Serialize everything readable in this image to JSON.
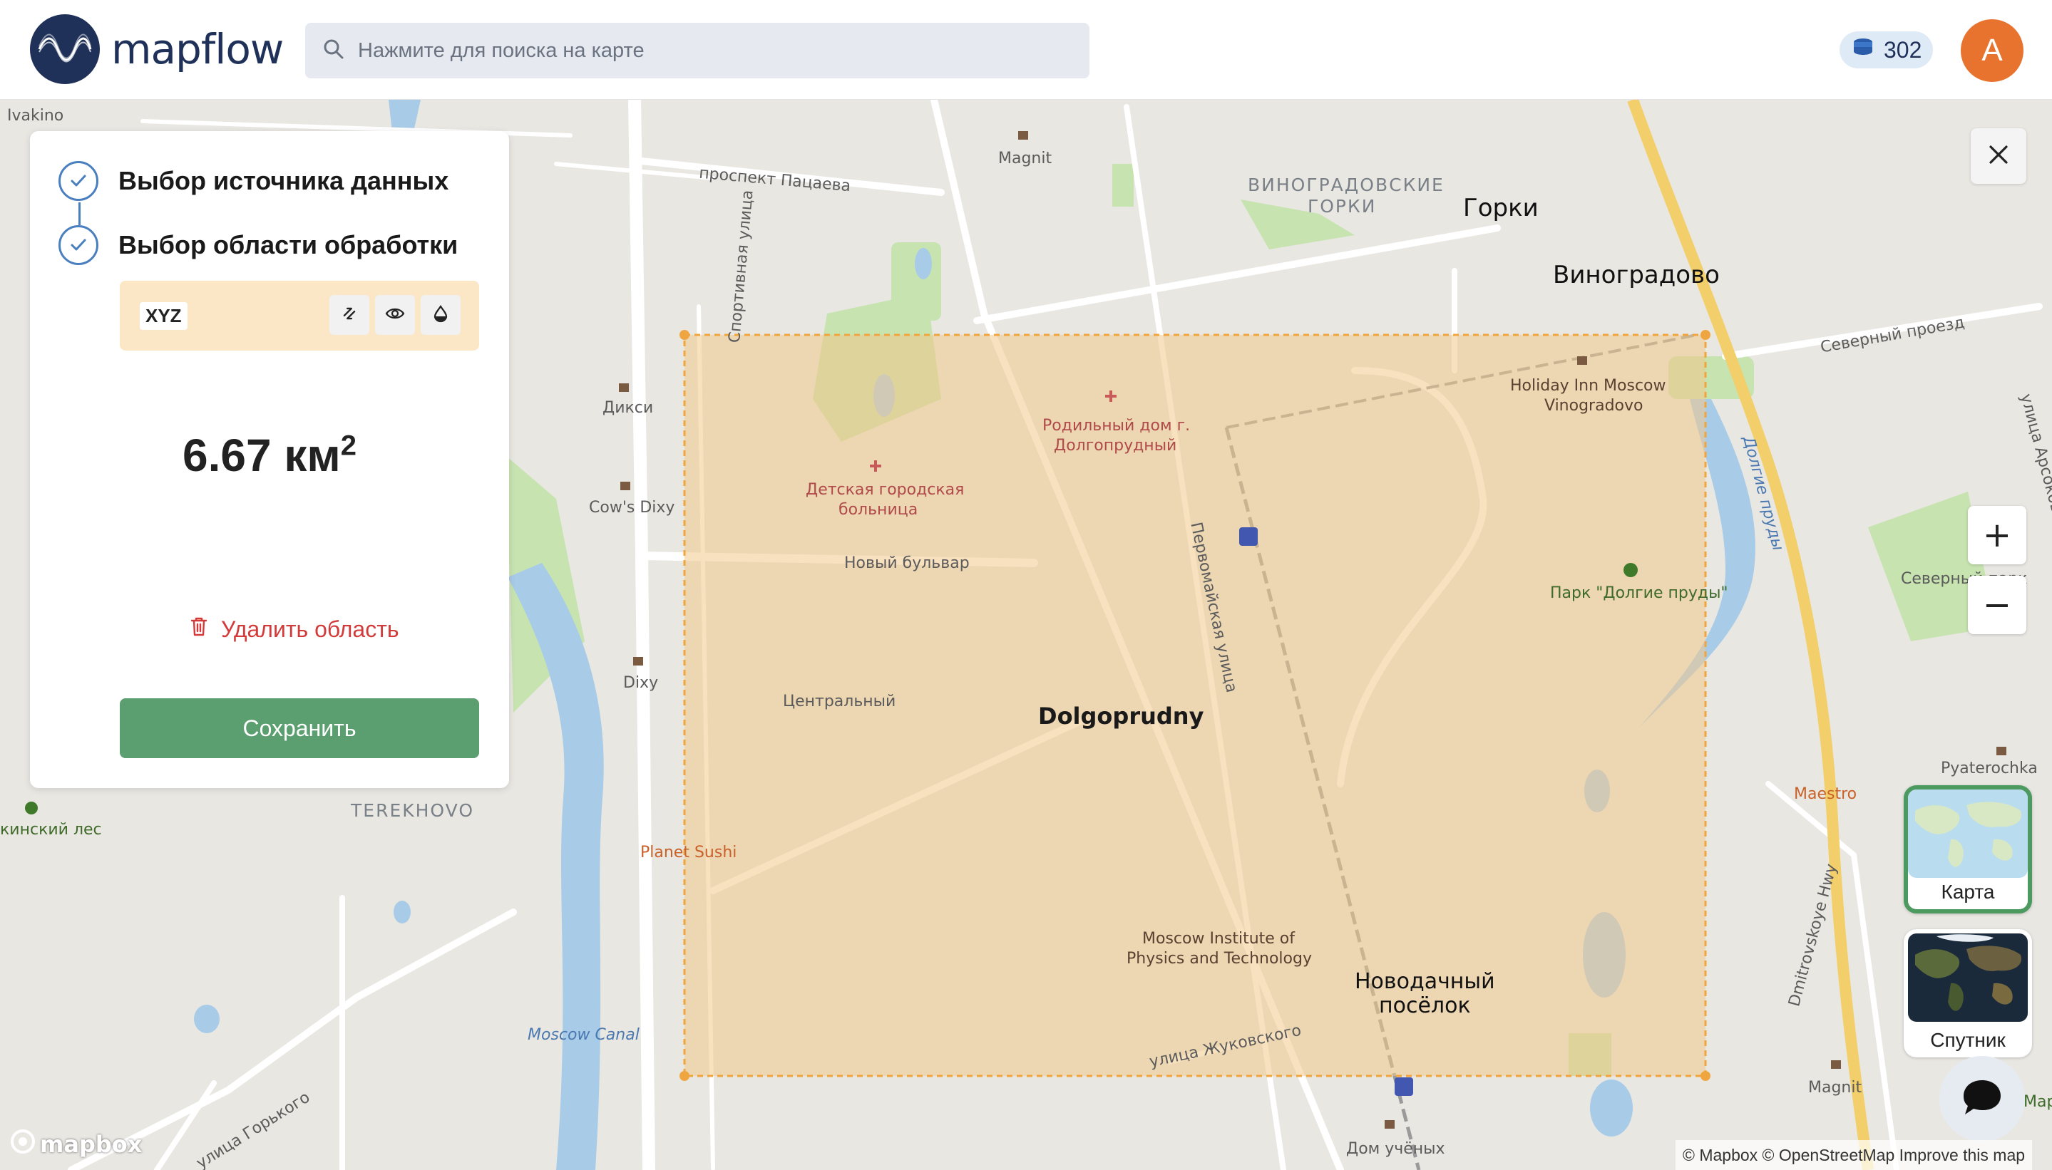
{
  "header": {
    "logo_text": "mapflow",
    "search_placeholder": "Нажмите для поиска на карте",
    "balance": "302",
    "avatar_initial": "A"
  },
  "panel": {
    "steps": [
      {
        "label": "Выбор источника данных",
        "done": true
      },
      {
        "label": "Выбор области обработки",
        "done": true
      }
    ],
    "layer_tag": "XYZ",
    "area_value": "6.67 км",
    "area_exponent": "2",
    "delete_label": "Удалить область",
    "save_label": "Сохранить"
  },
  "map_controls": {
    "zoom_in": "+",
    "zoom_out": "−",
    "layers": [
      {
        "label": "Карта",
        "active": true
      },
      {
        "label": "Спутник",
        "active": false
      }
    ]
  },
  "map_labels": {
    "ivakino": "Ivakino",
    "magnit_top": "Magnit",
    "prospekt": "проспект Пацаева",
    "vinogradovskie": "ВИНОГРАДОВСКИЕ",
    "gorki_district": "ГОРКИ",
    "gorki": "Горки",
    "vinogradovo": "Виноградово",
    "severny_proezd": "Северный проезд",
    "arsokova": "улица Арсокова",
    "sportivnaya": "Спортивная улица",
    "diksi": "Дикси",
    "cows_dixy": "Cow's Dixy",
    "rodilny_1": "Родильный дом г.",
    "rodilny_2": "Долгопрудный",
    "detskaya_1": "Детская городская",
    "detskaya_2": "больница",
    "holiday_1": "Holiday Inn Moscow",
    "holiday_2": "Vinogradovo",
    "dolgie_prudy": "Долгие пруды",
    "novy_bulvar": "Новый бульвар",
    "pervomayskaya": "Первомайская улица",
    "park": "Парк \"Долгие пруды\"",
    "severny_park": "Северный парк",
    "dixy": "Dixy",
    "centralny": "Центральный",
    "dolgoprudny": "Dolgoprudny",
    "terekhovo": "TEREKHOVO",
    "kinsky_les": "кинский лес",
    "pyaterochka": "Pyaterochka",
    "maestro": "Maestro",
    "planet_sushi": "Planet Sushi",
    "mipt_1": "Moscow Institute of",
    "mipt_2": "Physics and Technology",
    "novodachny_1": "Новодачный",
    "novodachny_2": "посёлок",
    "dmitrovskoye": "Dmitrovskoye Hwy",
    "moscow_canal": "Moscow Canal",
    "zhukovskogo": "улица Жуковского",
    "gorkogo": "улица Горького",
    "dom_uchenyh": "Дом учёных",
    "magnit_bottom": "Magnit",
    "map_cut": "Мар"
  },
  "footer": {
    "mapbox_logo": "mapbox",
    "attribution": "© Mapbox © OpenStreetMap Improve this map"
  },
  "colors": {
    "brand_navy": "#1f3158",
    "accent_blue": "#4a7fbf",
    "save_green": "#5b9e6f",
    "delete_red": "#d33b3b",
    "selection_fill": "#f0c98a",
    "selection_border": "#f0a640",
    "avatar_orange": "#e8732e"
  }
}
